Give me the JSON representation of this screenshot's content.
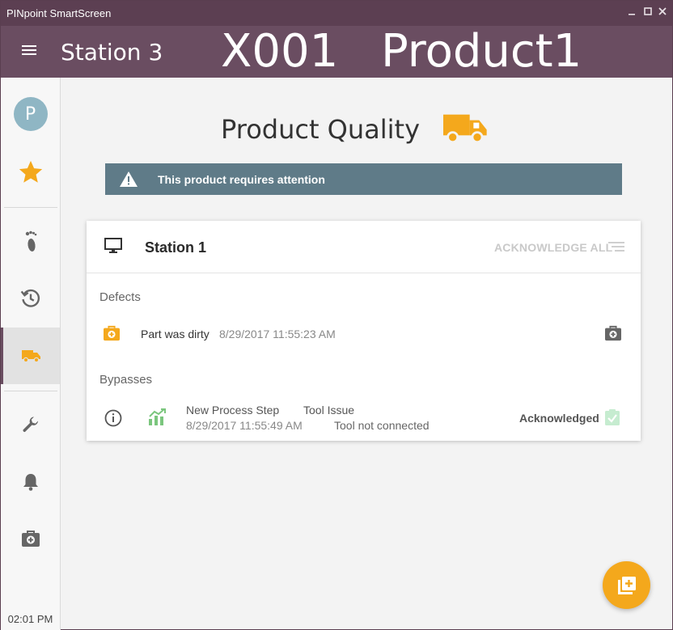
{
  "window": {
    "title": "PINpoint SmartScreen"
  },
  "header": {
    "station": "Station 3",
    "code": "X001",
    "product": "Product1"
  },
  "sidebar": {
    "avatar_initial": "P",
    "items": [
      {
        "icon": "avatar"
      },
      {
        "icon": "star-icon"
      },
      {
        "icon": "footprint-icon"
      },
      {
        "icon": "history-icon"
      },
      {
        "icon": "truck-icon",
        "active": true
      },
      {
        "icon": "wrench-icon"
      },
      {
        "icon": "bell-icon"
      },
      {
        "icon": "medical-kit-icon"
      }
    ],
    "clock": "02:01 PM"
  },
  "main": {
    "heading": "Product Quality",
    "alert": "This product requires attention",
    "card": {
      "title": "Station 1",
      "ack_all": "ACKNOWLEDGE ALL",
      "defects_label": "Defects",
      "defects": [
        {
          "description": "Part was dirty",
          "time": "8/29/2017 11:55:23 AM"
        }
      ],
      "bypasses_label": "Bypasses",
      "bypasses": [
        {
          "step": "New Process Step",
          "time": "8/29/2017 11:55:49 AM",
          "issue": "Tool Issue",
          "detail": "Tool not connected",
          "status": "Acknowledged"
        }
      ]
    }
  },
  "colors": {
    "titlebar": "#5c3f52",
    "header": "#6a4d61",
    "accent": "#f4a81c",
    "alert": "#5f7b88",
    "acknowledged": "#8fd69a"
  }
}
